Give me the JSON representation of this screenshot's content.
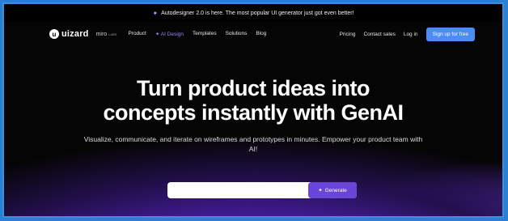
{
  "announcement": {
    "icon": "sparkle-icon",
    "text": "Autodesigner 2.0 is here. The most popular UI generator just got even better!"
  },
  "brand": {
    "logo": "uizard",
    "partner": "miro",
    "partner_suffix": "LABS"
  },
  "nav": {
    "links": [
      "Product",
      "AI Design",
      "Templates",
      "Solutions",
      "Blog"
    ],
    "right": [
      "Pricing",
      "Contact sales",
      "Log in"
    ],
    "cta": "Sign up for free"
  },
  "hero": {
    "title_line1": "Turn product ideas into",
    "title_line2": "concepts instantly with GenAI",
    "subtitle": "Visualize, communicate, and iterate on wireframes and prototypes in minutes. Empower your product team with AI!"
  },
  "prompt_form": {
    "value": "",
    "button": "Generate"
  },
  "colors": {
    "accent": "#6a45d8",
    "cta_blue": "#4c8cf5",
    "frame": "#3b8fe0"
  }
}
